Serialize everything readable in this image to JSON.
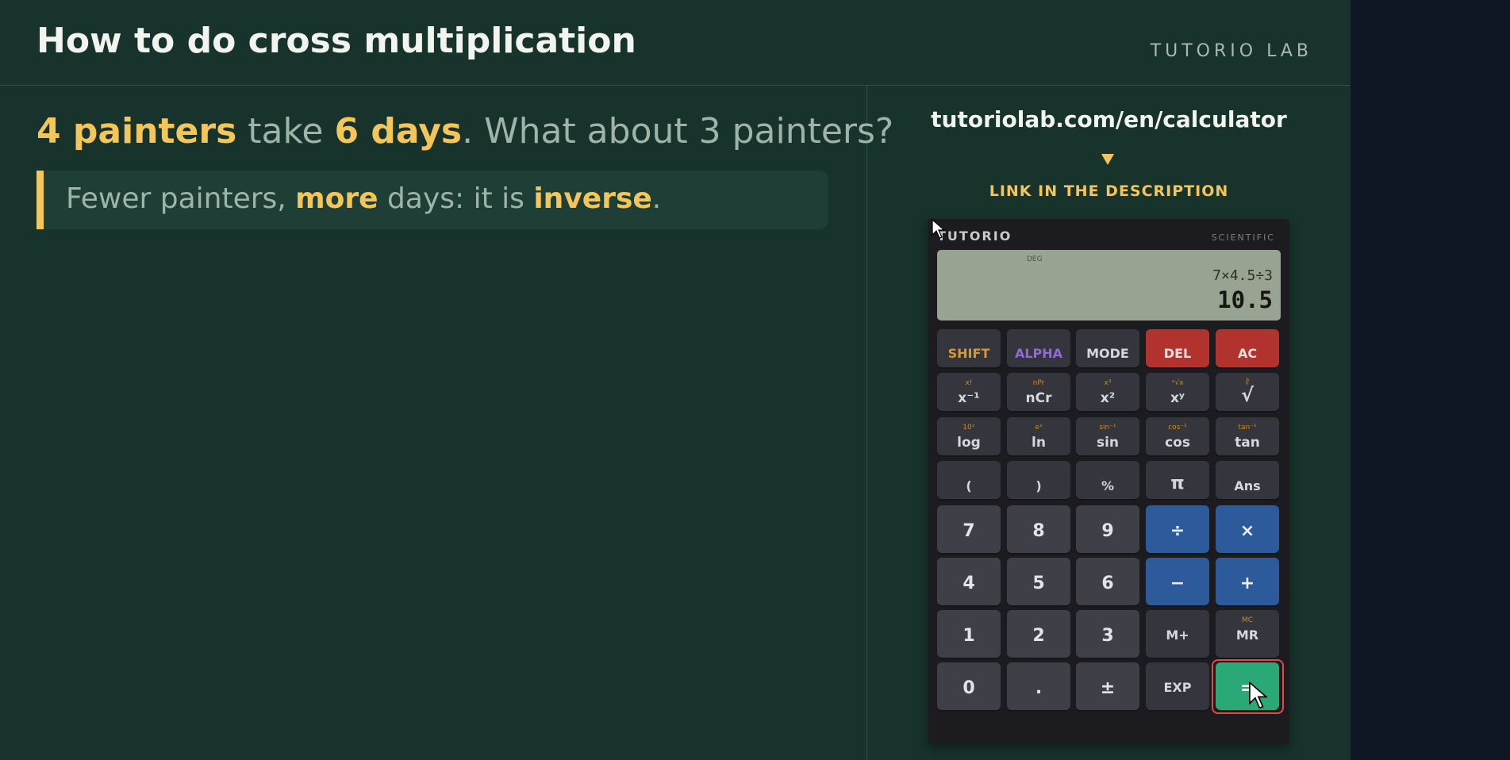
{
  "header": {
    "title": "How to do cross multiplication",
    "brand": "TUTORIO LAB"
  },
  "question": {
    "part1": "4 painters",
    "part2": " take ",
    "part3": "6 days",
    "part4": ". What about 3 painters?"
  },
  "note": {
    "part1": "Fewer painters, ",
    "part2": "more",
    "part3": " days: it is ",
    "part4": "inverse",
    "part5": "."
  },
  "promo": {
    "url": "tutoriolab.com/en/calculator",
    "link_text": "LINK IN THE DESCRIPTION"
  },
  "calculator": {
    "brand": "TUTORIO",
    "mode": "SCIENTIFIC",
    "angle_unit": "DEG",
    "expression": "7×4.5÷3",
    "result": "10.5",
    "keys": {
      "shift": "SHIFT",
      "alpha": "ALPHA",
      "mode": "MODE",
      "del": "DEL",
      "ac": "AC",
      "inv": "x⁻¹",
      "inv_shift": "x!",
      "ncr": "nCr",
      "ncr_shift": "nPr",
      "sq": "x²",
      "sq_shift": "x³",
      "pow": "xʸ",
      "pow_shift": "ˣ√x",
      "sqrt": "√",
      "sqrt_shift": "∛",
      "log": "log",
      "log_shift": "10ˣ",
      "ln": "ln",
      "ln_shift": "eˣ",
      "sin": "sin",
      "sin_shift": "sin⁻¹",
      "cos": "cos",
      "cos_shift": "cos⁻¹",
      "tan": "tan",
      "tan_shift": "tan⁻¹",
      "lparen": "(",
      "rparen": ")",
      "percent": "%",
      "pi": "π",
      "ans": "Ans",
      "d7": "7",
      "d8": "8",
      "d9": "9",
      "div": "÷",
      "mul": "×",
      "d4": "4",
      "d5": "5",
      "d6": "6",
      "sub": "−",
      "add": "+",
      "d1": "1",
      "d2": "2",
      "d3": "3",
      "mplus": "M+",
      "mr": "MR",
      "mr_shift": "MC",
      "d0": "0",
      "dot": ".",
      "neg": "±",
      "exp": "EXP",
      "eq": "="
    }
  },
  "colors": {
    "background": "#17332b",
    "accent": "#f4c65a",
    "equals": "#2aa876",
    "operator": "#2c5a9a",
    "danger": "#b2322e"
  },
  "icons": {
    "pointer": "mouse-pointer-icon",
    "arrow": "down-arrow-icon"
  }
}
